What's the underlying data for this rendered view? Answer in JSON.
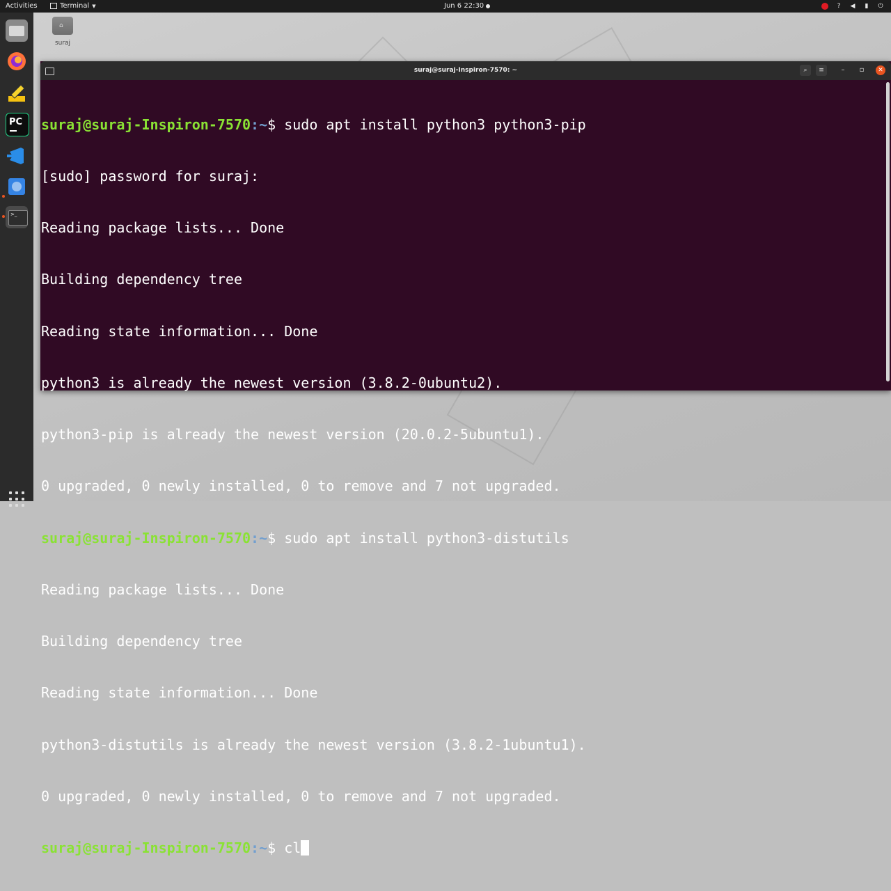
{
  "topbar": {
    "activities": "Activities",
    "app_menu": "Terminal",
    "clock": "Jun 6  22:30"
  },
  "desktop": {
    "home_label": "suraj"
  },
  "window": {
    "title": "suraj@suraj-Inspiron-7570: ~"
  },
  "terminal": {
    "prompt_user": "suraj@suraj-Inspiron-7570",
    "prompt_path": ":~",
    "prompt_symbol": "$ ",
    "commands": [
      "sudo apt install python3 python3-pip",
      "sudo apt install python3-distutils"
    ],
    "output_block_1": [
      "[sudo] password for suraj:",
      "Reading package lists... Done",
      "Building dependency tree",
      "Reading state information... Done",
      "python3 is already the newest version (3.8.2-0ubuntu2).",
      "python3-pip is already the newest version (20.0.2-5ubuntu1).",
      "0 upgraded, 0 newly installed, 0 to remove and 7 not upgraded."
    ],
    "output_block_2": [
      "Reading package lists... Done",
      "Building dependency tree",
      "Reading state information... Done",
      "python3-distutils is already the newest version (3.8.2-1ubuntu1).",
      "0 upgraded, 0 newly installed, 0 to remove and 7 not upgraded."
    ],
    "current_input": "cl"
  },
  "colors": {
    "terminal_bg": "#300a24",
    "prompt_user": "#8ae234",
    "prompt_path": "#729fcf",
    "accent": "#e95420"
  },
  "icons": {
    "dock": [
      "files-icon",
      "firefox-icon",
      "text-editor-icon",
      "pycharm-icon",
      "vscode-icon",
      "software-icon",
      "terminal-icon",
      "show-apps-icon"
    ],
    "tray": [
      "record-icon",
      "help-icon",
      "volume-icon",
      "battery-icon",
      "power-icon"
    ]
  }
}
